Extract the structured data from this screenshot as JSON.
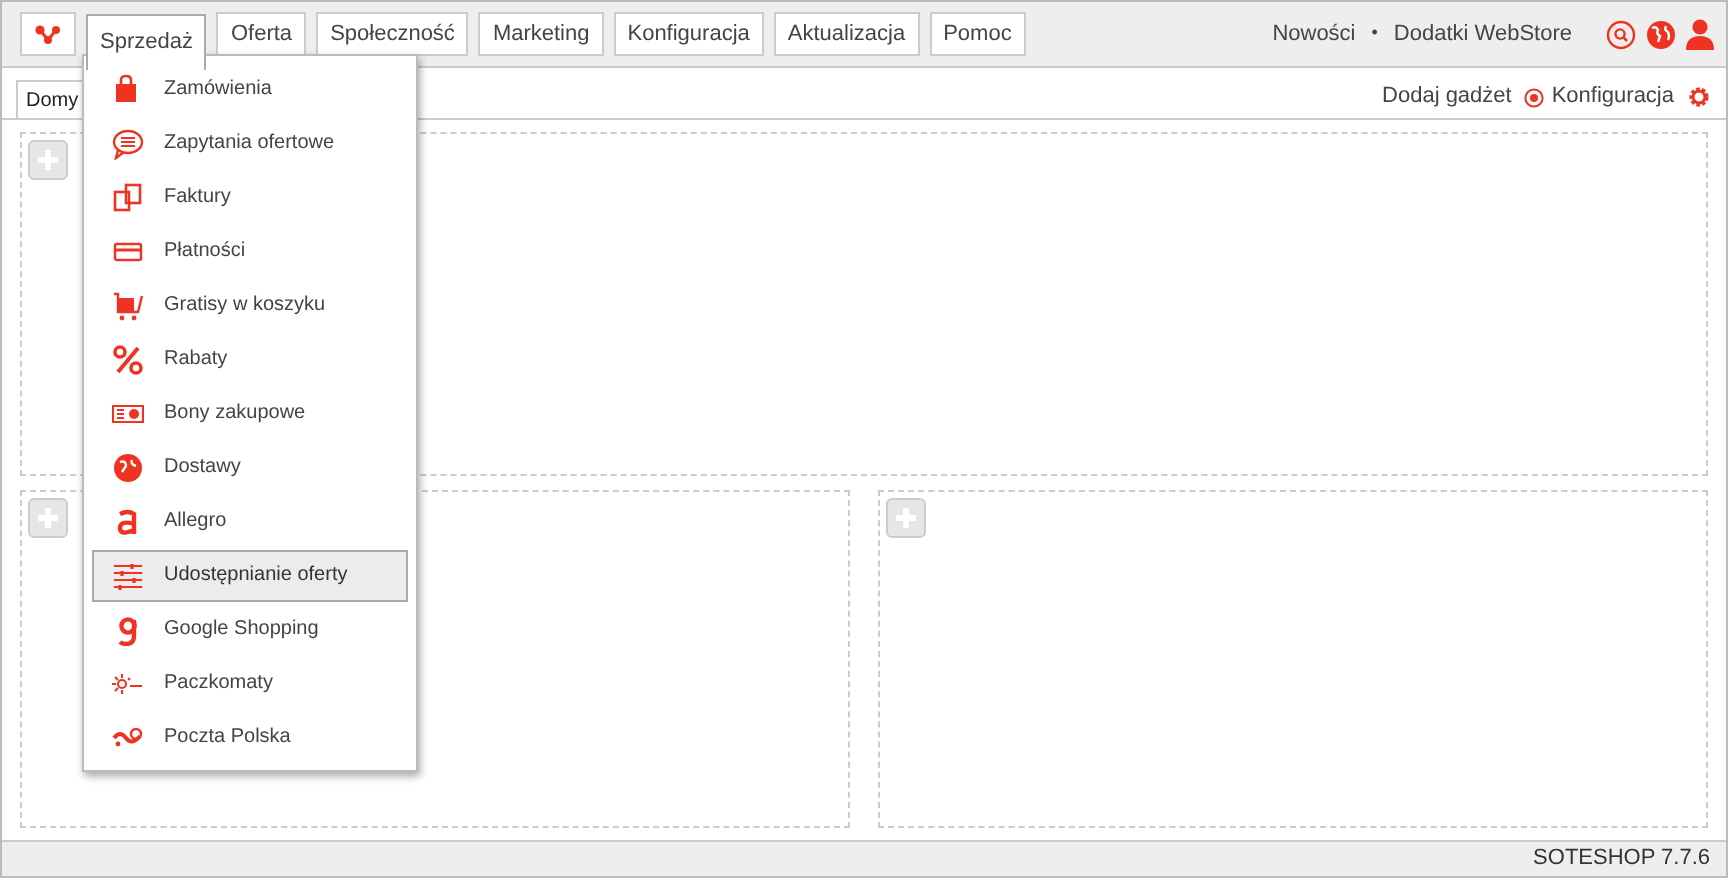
{
  "nav": [
    {
      "label": "Sprzedaż",
      "selected": true
    },
    {
      "label": "Oferta",
      "selected": false
    },
    {
      "label": "Społeczność",
      "selected": false
    },
    {
      "label": "Marketing",
      "selected": false
    },
    {
      "label": "Konfiguracja",
      "selected": false
    },
    {
      "label": "Aktualizacja",
      "selected": false
    },
    {
      "label": "Pomoc",
      "selected": false
    }
  ],
  "top_links": [
    "Nowości",
    "Dodatki WebStore"
  ],
  "top_separator": "•",
  "tabs": [
    {
      "label": "Domy",
      "selected": true
    }
  ],
  "toolbar": {
    "add_gadget": "Dodaj gadżet",
    "configuration": "Konfiguracja"
  },
  "menu": [
    {
      "label": "Zamówienia",
      "selected": false
    },
    {
      "label": "Zapytania ofertowe",
      "selected": false
    },
    {
      "label": "Faktury",
      "selected": false
    },
    {
      "label": "Płatności",
      "selected": false
    },
    {
      "label": "Gratisy w koszyku",
      "selected": false
    },
    {
      "label": "Rabaty",
      "selected": false
    },
    {
      "label": "Bony zakupowe",
      "selected": false
    },
    {
      "label": "Dostawy",
      "selected": false
    },
    {
      "label": "Allegro",
      "selected": false
    },
    {
      "label": "Udostępnianie oferty",
      "selected": true
    },
    {
      "label": "Google Shopping",
      "selected": false
    },
    {
      "label": "Paczkomaty",
      "selected": false
    },
    {
      "label": "Poczta Polska",
      "selected": false
    }
  ],
  "status_bar": {
    "version": "SOTESHOP 7.7.6"
  }
}
